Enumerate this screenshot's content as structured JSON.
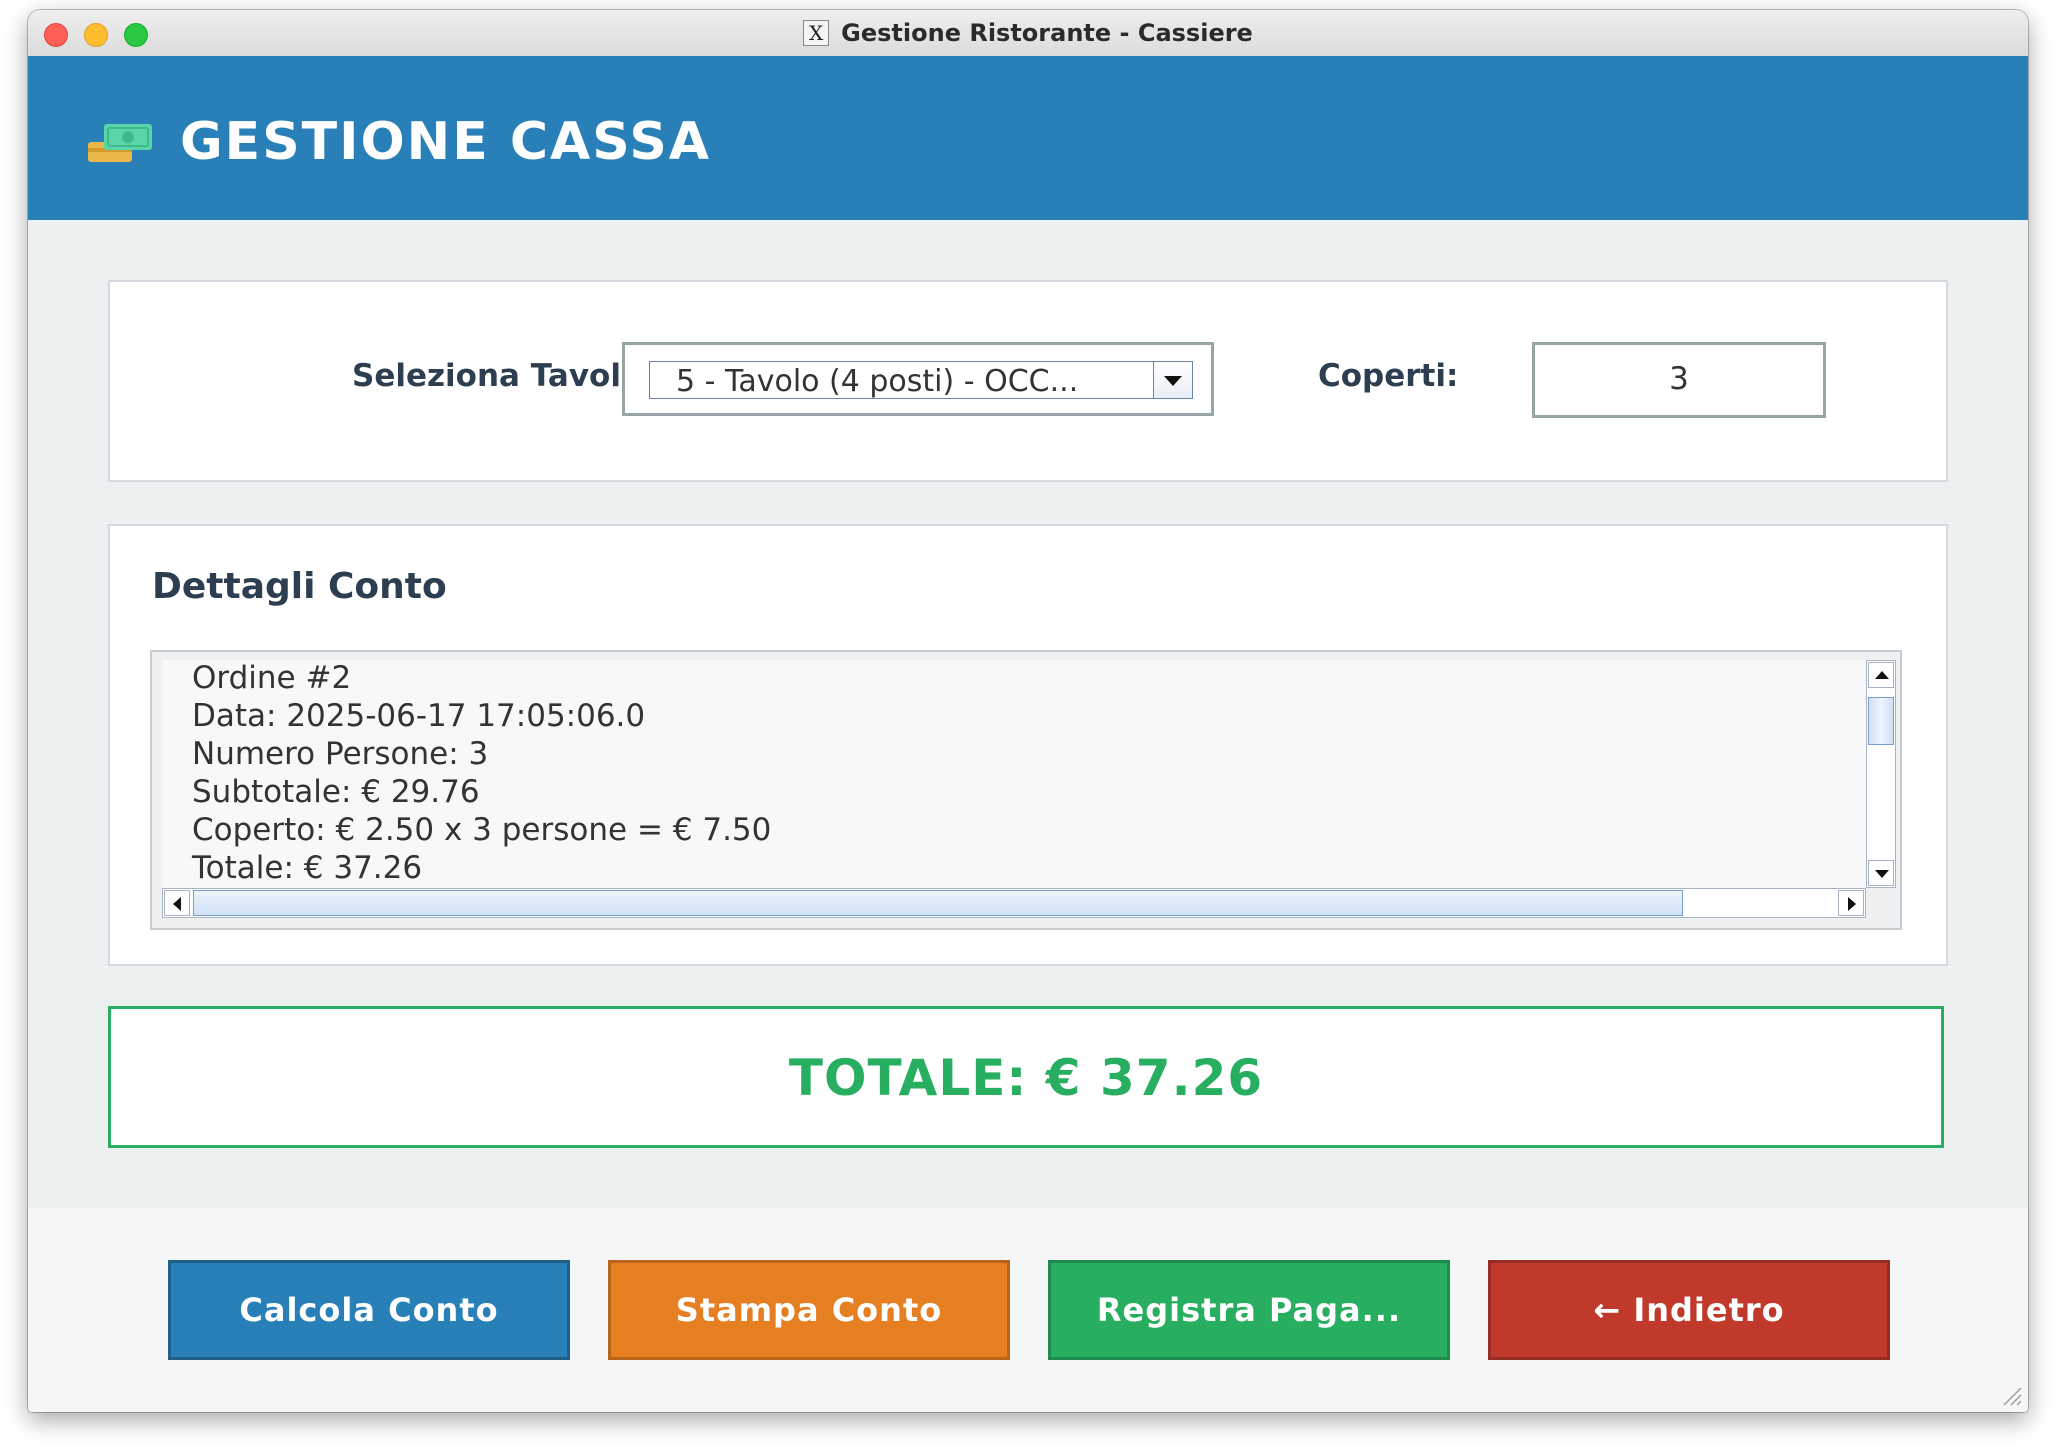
{
  "window": {
    "title": "Gestione Ristorante - Cassiere"
  },
  "header": {
    "title": "GESTIONE CASSA",
    "icon": "cash-icon"
  },
  "table_select": {
    "label": "Seleziona Tavolo:",
    "selected": "5 - Tavolo  (4 posti) - OCC..."
  },
  "covers": {
    "label": "Coperti:",
    "value": "3"
  },
  "details": {
    "title": "Dettagli Conto",
    "lines": [
      "Ordine #2",
      "Data: 2025-06-17 17:05:06.0",
      "Numero Persone: 3",
      "Subtotale: € 29.76",
      "Coperto: € 2.50 x 3 persone = € 7.50",
      "Totale: € 37.26"
    ]
  },
  "total": {
    "text": "TOTALE: € 37.26"
  },
  "buttons": {
    "calculate": "Calcola Conto",
    "print": "Stampa Conto",
    "register": "Registra Paga...",
    "back": "← Indietro"
  },
  "colors": {
    "header": "#2980b9",
    "total": "#27ae60",
    "calculate": "#2980b9",
    "print": "#e67e22",
    "register": "#27ae60",
    "back": "#c0392b"
  }
}
